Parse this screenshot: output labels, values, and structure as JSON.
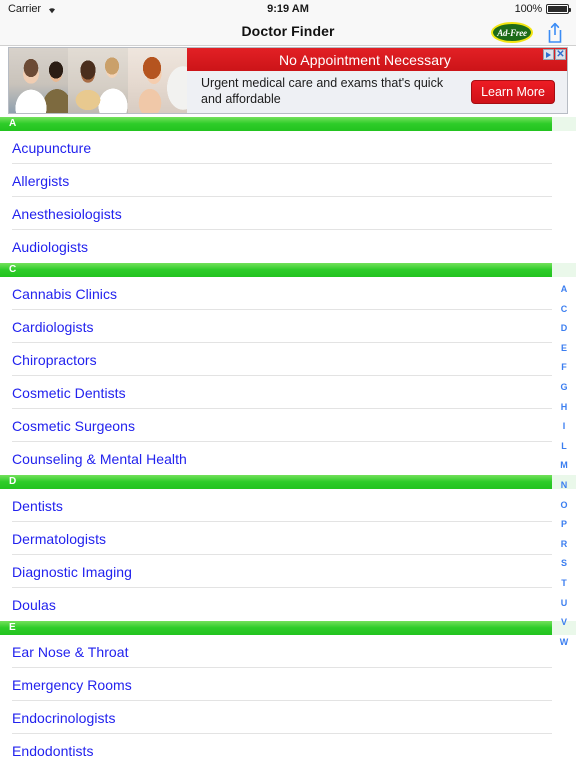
{
  "status_bar": {
    "carrier": "Carrier",
    "wifi_icon": "wifi-icon",
    "time": "9:19 AM",
    "battery_percent": "100%",
    "battery_icon": "battery-full-icon"
  },
  "nav_bar": {
    "title": "Doctor Finder",
    "adfree_label": "Ad-Free",
    "share_icon": "share-icon"
  },
  "ad": {
    "headline": "No Appointment Necessary",
    "body": "Urgent medical care and exams that's quick and affordable",
    "cta_label": "Learn More",
    "adchoices_triangle_icon": "adchoices-triangle-icon",
    "adchoices_close_icon": "adchoices-close-icon",
    "photo_alt_1": "doctor-examining-child-photo",
    "photo_alt_2": "child-with-stethoscope-photo",
    "photo_alt_3": "doctor-checking-throat-photo"
  },
  "list": {
    "sections": [
      {
        "letter": "A",
        "items": [
          "Acupuncture",
          "Allergists",
          "Anesthesiologists",
          "Audiologists"
        ]
      },
      {
        "letter": "C",
        "items": [
          "Cannabis Clinics",
          "Cardiologists",
          "Chiropractors",
          "Cosmetic Dentists",
          "Cosmetic Surgeons",
          "Counseling & Mental Health"
        ]
      },
      {
        "letter": "D",
        "items": [
          "Dentists",
          "Dermatologists",
          "Diagnostic Imaging",
          "Doulas"
        ]
      },
      {
        "letter": "E",
        "items": [
          "Ear Nose & Throat",
          "Emergency Rooms",
          "Endocrinologists",
          "Endodontists"
        ]
      }
    ]
  },
  "index_strip": {
    "letters": [
      "A",
      "C",
      "D",
      "E",
      "F",
      "G",
      "H",
      "I",
      "L",
      "M",
      "N",
      "O",
      "P",
      "R",
      "S",
      "T",
      "U",
      "V",
      "W"
    ]
  },
  "colors": {
    "section_green": "#2ecc29",
    "link_blue": "#2222ee",
    "index_blue": "#3b7ef0",
    "ad_red": "#e22025",
    "badge_green": "#1d6b18",
    "badge_ring_yellow": "#f2e511"
  }
}
